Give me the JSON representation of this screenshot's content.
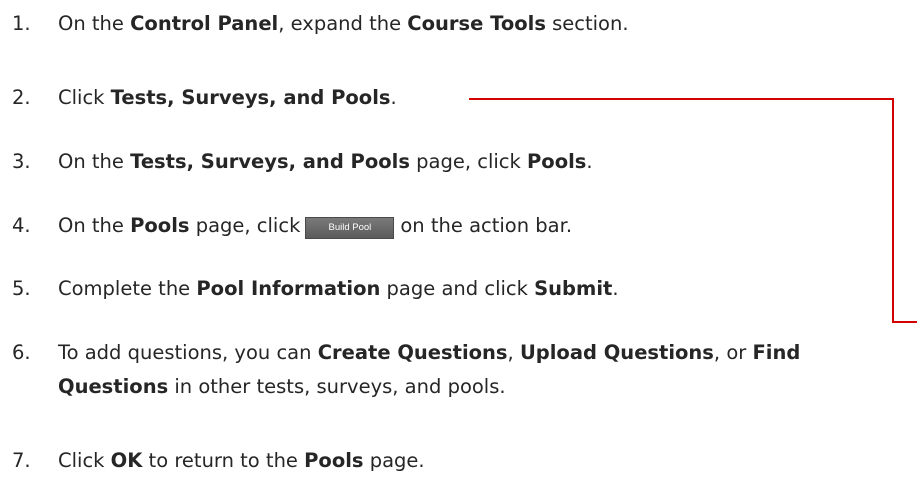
{
  "steps": [
    {
      "number": "1.",
      "parts": [
        {
          "t": "On the "
        },
        {
          "t": "Control Panel",
          "b": true
        },
        {
          "t": ", expand the "
        },
        {
          "t": "Course Tools",
          "b": true
        },
        {
          "t": " section."
        }
      ]
    },
    {
      "number": "2.",
      "parts": [
        {
          "t": "Click "
        },
        {
          "t": "Tests, Surveys, and Pools",
          "b": true
        },
        {
          "t": "."
        }
      ]
    },
    {
      "number": "3.",
      "parts": [
        {
          "t": "On the "
        },
        {
          "t": "Tests, Surveys, and Pools",
          "b": true
        },
        {
          "t": " page, click "
        },
        {
          "t": "Pools",
          "b": true
        },
        {
          "t": "."
        }
      ]
    },
    {
      "number": "4.",
      "parts": [
        {
          "t": "On the "
        },
        {
          "t": "Pools",
          "b": true
        },
        {
          "t": " page, click"
        },
        {
          "button": true
        },
        {
          "t": "on the action bar."
        }
      ]
    },
    {
      "number": "5.",
      "parts": [
        {
          "t": "Complete the "
        },
        {
          "t": "Pool Information",
          "b": true
        },
        {
          "t": " page and click "
        },
        {
          "t": "Submit",
          "b": true
        },
        {
          "t": "."
        }
      ]
    },
    {
      "number": "6.",
      "parts": [
        {
          "t": "To add questions, you can "
        },
        {
          "t": "Create Questions",
          "b": true
        },
        {
          "t": ", "
        },
        {
          "t": "Upload Questions",
          "b": true
        },
        {
          "t": ", or "
        },
        {
          "t": "Find",
          "b": true
        }
      ],
      "continuation": [
        {
          "t": "Questions",
          "b": true
        },
        {
          "t": " in other tests, surveys, and pools."
        }
      ]
    },
    {
      "number": "7.",
      "parts": [
        {
          "t": "Click "
        },
        {
          "t": "OK",
          "b": true
        },
        {
          "t": " to return to the "
        },
        {
          "t": "Pools",
          "b": true
        },
        {
          "t": " page."
        }
      ]
    }
  ],
  "build_pool_button": {
    "label": "Build Pool"
  },
  "colors": {
    "connector": "#d40000",
    "text": "#262626",
    "button_bg": "#666666"
  }
}
